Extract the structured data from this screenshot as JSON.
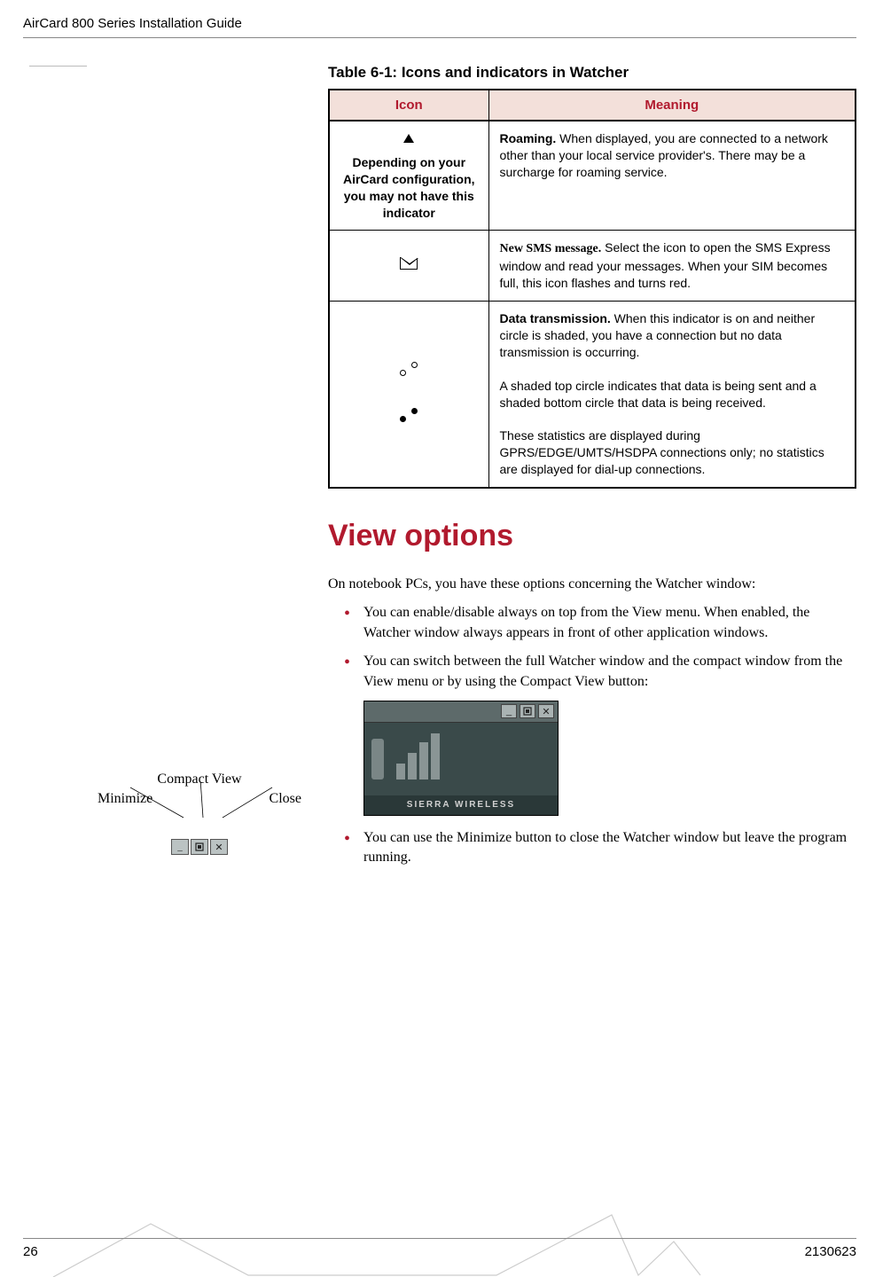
{
  "header": {
    "title": "AirCard 800 Series Installation Guide"
  },
  "table": {
    "title": "Table 6-1:  Icons and indicators in Watcher",
    "columns": {
      "icon": "Icon",
      "meaning": "Meaning"
    },
    "rows": [
      {
        "icon_caption": "Depending on your AirCard configuration, you may not have this indicator",
        "meaning_bold": "Roaming.",
        "meaning": " When displayed, you are connected to a network other than your local service provider's. There may be a surcharge for roaming service."
      },
      {
        "meaning_bold_serif": "New SMS message.",
        "meaning": " Select the icon to open the SMS Express window and read your messages. When your SIM becomes full, this icon flashes and turns red."
      },
      {
        "meaning_bold": "Data transmission.",
        "meaning_p1": " When this indicator is on and neither circle is shaded, you have a connection but no data transmission is occurring.",
        "meaning_p2": "A shaded top circle indicates that data is being sent and a shaded bottom circle that data is being received.",
        "meaning_p3": "These statistics are displayed during GPRS/EDGE/UMTS/HSDPA connections only; no statistics are displayed for dial-up connections."
      }
    ]
  },
  "section": {
    "heading": "View options",
    "intro": "On notebook PCs, you have these options concerning the Watcher window:",
    "bullets": [
      "You can enable/disable always on top from the View menu. When enabled, the Watcher window always appears in front of other application windows.",
      "You can switch between the full Watcher window and the compact window from the View menu or by using the Compact View button:"
    ],
    "bullet_after_image": "You can use the Minimize button to close the Watcher window but leave the program running."
  },
  "sidebar": {
    "compact_view": "Compact View",
    "minimize": "Minimize",
    "close": "Close"
  },
  "compact_window": {
    "brand": "SIERRA WIRELESS"
  },
  "footer": {
    "page_number": "26",
    "doc_number": "2130623"
  }
}
